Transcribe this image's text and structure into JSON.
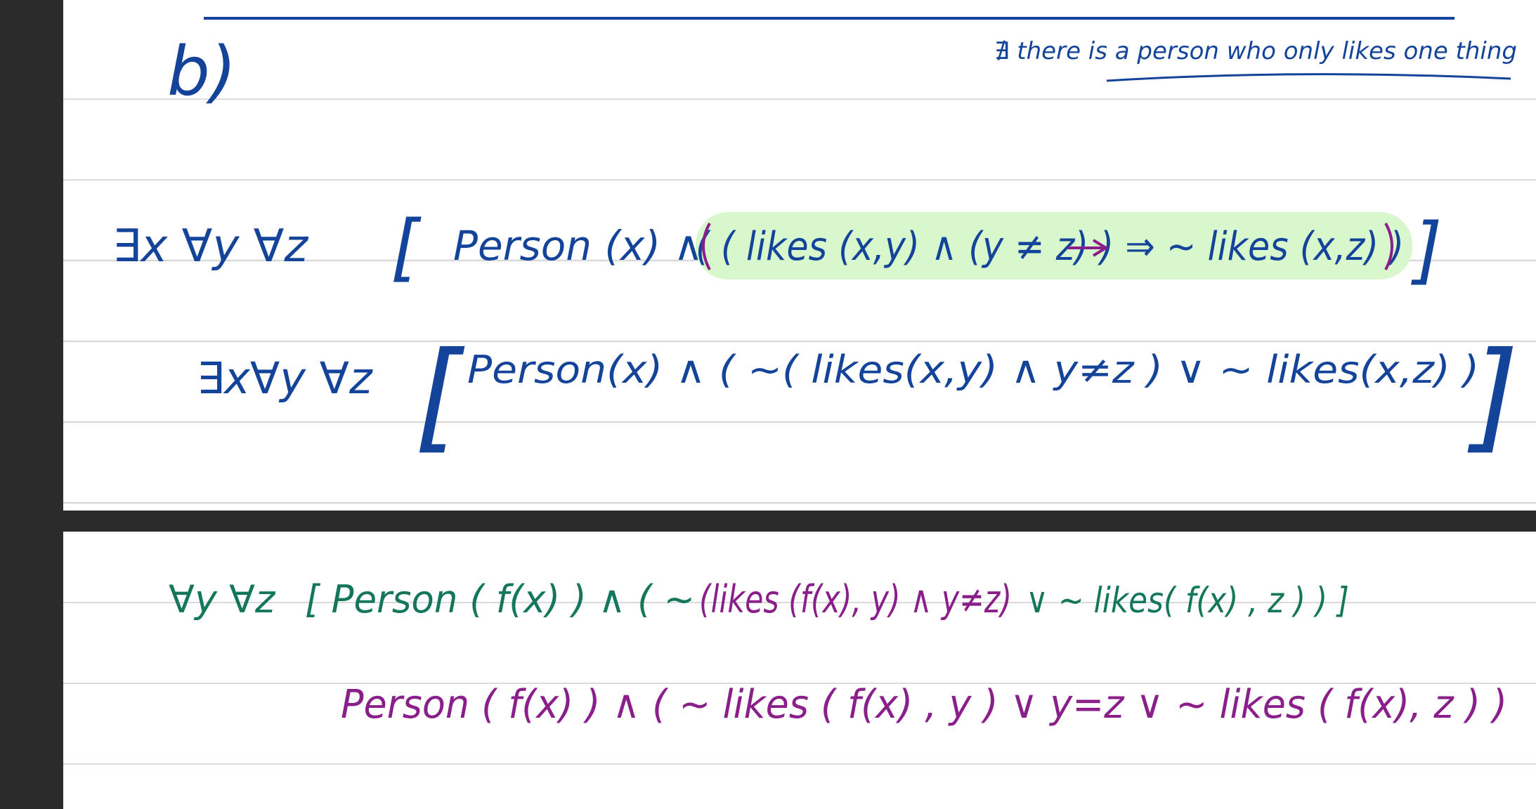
{
  "top_section": {
    "part_label": "b)",
    "note": "∄ there is a person who only likes one thing",
    "line1": {
      "quantifiers": "∃x ∀y ∀z",
      "open_bracket": "[",
      "person": "Person (x) ∧",
      "implication": "( ( likes (x,y) ∧ (y ≠ z) ) ⇒ ∼ likes (x,z) )",
      "close_bracket": "]"
    },
    "line2": {
      "quantifiers": "∃x∀y ∀z",
      "open_bracket": "[",
      "body": "Person(x) ∧ ( ∼( likes(x,y) ∧ y≠z ) ∨ ∼ likes(x,z) )",
      "close_bracket": "]"
    }
  },
  "bottom_section": {
    "line1": {
      "quantifiers": "∀y ∀z",
      "body_start": "[ Person ( f(x) ) ∧ ( ∼",
      "body_purple": "(likes (f(x), y) ∧ y≠z)",
      "body_end": "∨ ∼ likes( f(x) , z ) ) ]"
    },
    "line2": {
      "body": "Person ( f(x) ) ∧ ( ∼ likes ( f(x) , y ) ∨ y=z ∨ ∼ likes ( f(x), z ) )"
    }
  },
  "colors": {
    "blue_ink": "#14449a",
    "green_ink": "#14765a",
    "purple_ink": "#8a1e8a",
    "highlight": "#d9f7cc",
    "page_background": "#ffffff",
    "gap_background": "#2b2b2b"
  }
}
